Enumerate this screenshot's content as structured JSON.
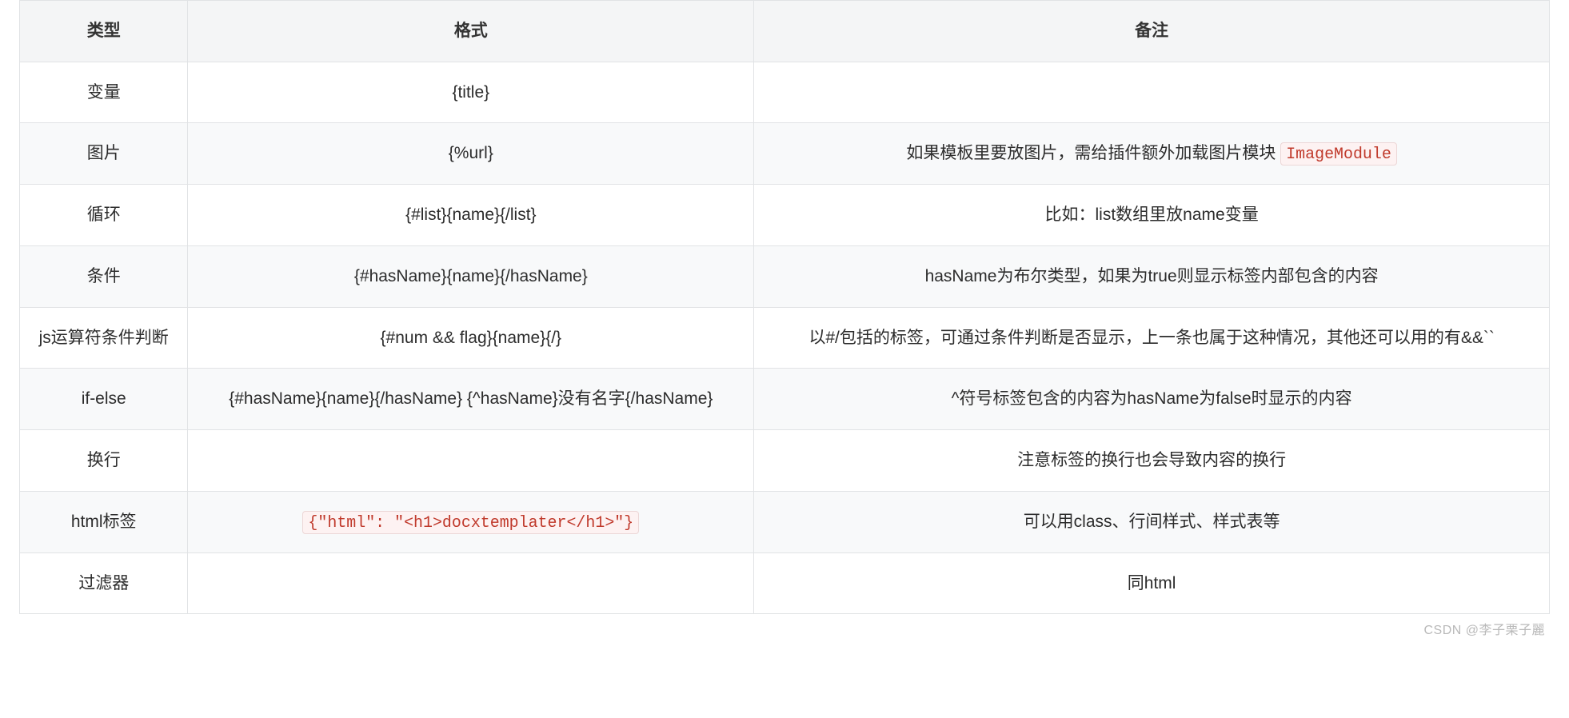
{
  "table": {
    "headers": {
      "type": "类型",
      "format": "格式",
      "note": "备注"
    },
    "rows": [
      {
        "type": "变量",
        "format": "{title}",
        "note": ""
      },
      {
        "type": "图片",
        "format": "{%url}",
        "note_pre": "如果模板里要放图片，需给插件额外加载图片模块 ",
        "note_code": "ImageModule"
      },
      {
        "type": "循环",
        "format": "{#list}{name}{/list}",
        "note": "比如：list数组里放name变量"
      },
      {
        "type": "条件",
        "format": "{#hasName}{name}{/hasName}",
        "note": "hasName为布尔类型，如果为true则显示标签内部包含的内容"
      },
      {
        "type": "js运算符条件判断",
        "format": "{#num && flag}{name}{/}",
        "note": "以#/包括的标签，可通过条件判断是否显示，上一条也属于这种情况，其他还可以用的有&&``"
      },
      {
        "type": "if-else",
        "format": "{#hasName}{name}{/hasName} {^hasName}没有名字{/hasName}",
        "note": "^符号标签包含的内容为hasName为false时显示的内容"
      },
      {
        "type": "换行",
        "format": "",
        "note": "注意标签的换行也会导致内容的换行"
      },
      {
        "type": "html标签",
        "format_code": "{\"html\": \"<h1>docxtemplater</h1>\"}",
        "note": "可以用class、行间样式、样式表等"
      },
      {
        "type": "过滤器",
        "format": "",
        "note": "同html"
      }
    ]
  },
  "watermark": "CSDN @李子栗子麗"
}
